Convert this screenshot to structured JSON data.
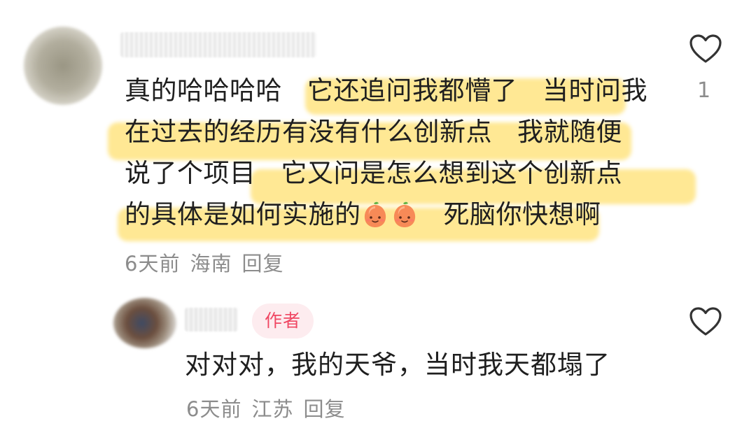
{
  "comment": {
    "text_lines": [
      {
        "segments": [
          "真的哈哈哈哈",
          "它还追问我都懵了",
          "当时问我"
        ]
      },
      {
        "segments": [
          "在过去的经历有没有什么创新点",
          "我就随便"
        ]
      },
      {
        "segments": [
          "说了个项目",
          "它又问是怎么想到这个创新点"
        ]
      },
      {
        "segments": [
          "的具体是如何实施的",
          "死脑你快想啊"
        ]
      }
    ],
    "time": "6天前",
    "location": "海南",
    "reply_label": "回复",
    "like_count": "1"
  },
  "reply": {
    "badge": "作者",
    "text": "对对对，我的天爷，当时我天都塌了",
    "time": "6天前",
    "location": "江苏",
    "reply_label": "回复"
  },
  "icons": {
    "like": "heart-outline-icon",
    "emoji": "peach-face-emoji-icon"
  },
  "colors": {
    "highlight": "#FFD63C",
    "meta_text": "#8C8C8C",
    "badge_text": "#F04763",
    "badge_bg": "#FDECEF"
  }
}
